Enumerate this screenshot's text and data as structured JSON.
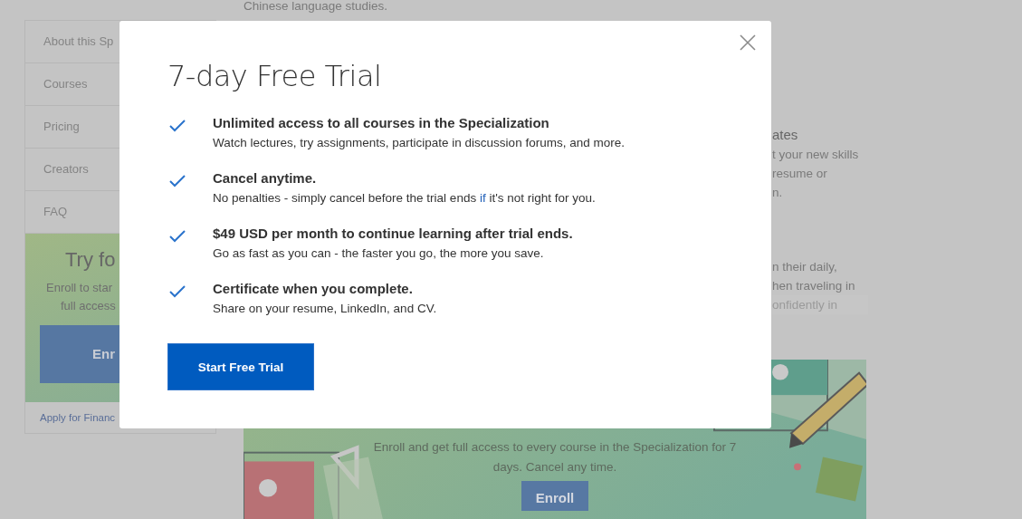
{
  "background_page": {
    "intro_text": "Chinese language studies.",
    "sidebar": {
      "items": [
        {
          "label": "About this Sp"
        },
        {
          "label": "Courses"
        },
        {
          "label": "Pricing"
        },
        {
          "label": "Creators"
        },
        {
          "label": "FAQ"
        }
      ],
      "promo": {
        "title": "Try fo",
        "lines": [
          "Enroll to star",
          "full access"
        ],
        "button": "Enr"
      },
      "financial_aid_link": "Apply for Financ"
    },
    "certificates": {
      "heading": "ates",
      "lines": [
        "t your new skills",
        "resume or",
        "n."
      ]
    },
    "usage": {
      "lines": [
        "n their daily,",
        "hen traveling in",
        "onfidently in"
      ]
    },
    "trial_banner": {
      "kind": "picture",
      "text_lines": [
        "Enroll and get full access to every course in the Specialization for 7",
        "days. Cancel any time."
      ],
      "button": "Enroll"
    }
  },
  "modal": {
    "title": "7-day Free Trial",
    "features": [
      {
        "title": "Unlimited access to all courses in the Specialization",
        "description": [
          {
            "kind": "plain",
            "text": "Watch lectures, try assignments, participate in discussion forums, and more."
          }
        ]
      },
      {
        "title": "Cancel anytime.",
        "description": [
          {
            "kind": "plain",
            "text": "No penalties - simply cancel before the trial ends "
          },
          {
            "kind": "link",
            "text": "if"
          },
          {
            "kind": "plain",
            "text": " it's not right for you."
          }
        ]
      },
      {
        "title": "$49 USD per month to continue learning after trial ends.",
        "description": [
          {
            "kind": "plain",
            "text": "Go as fast as you can - the faster you go, the more you save."
          }
        ]
      },
      {
        "title": "Certificate when you complete.",
        "description": [
          {
            "kind": "plain",
            "text": "Share on your resume, LinkedIn, and CV."
          }
        ]
      }
    ],
    "button": "Start Free Trial"
  }
}
